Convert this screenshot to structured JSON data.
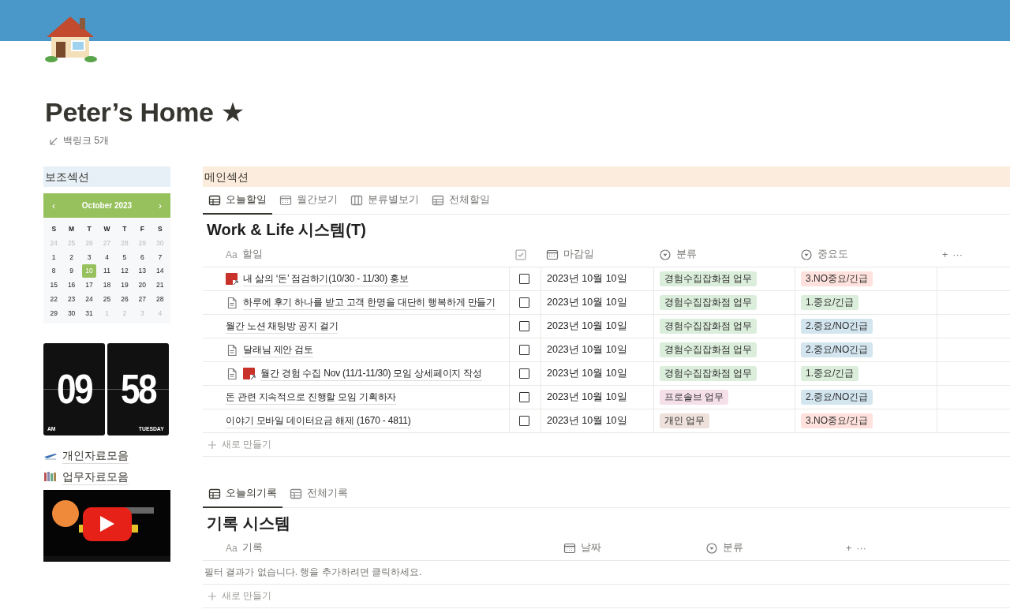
{
  "header": {
    "title": "Peter’s Home ★",
    "backlinks": "백링크 5개"
  },
  "sidebar": {
    "heading": "보조섹션",
    "calendar": {
      "prev": "‹",
      "month": "October 2023",
      "next": "›",
      "weekdays": [
        "S",
        "M",
        "T",
        "W",
        "T",
        "F",
        "S"
      ],
      "days": [
        {
          "day": "24",
          "muted": true,
          "selected": false
        },
        {
          "day": "25",
          "muted": true,
          "selected": false
        },
        {
          "day": "26",
          "muted": true,
          "selected": false
        },
        {
          "day": "27",
          "muted": true,
          "selected": false
        },
        {
          "day": "28",
          "muted": true,
          "selected": false
        },
        {
          "day": "29",
          "muted": true,
          "selected": false
        },
        {
          "day": "30",
          "muted": true,
          "selected": false
        },
        {
          "day": "1",
          "muted": false,
          "selected": false
        },
        {
          "day": "2",
          "muted": false,
          "selected": false
        },
        {
          "day": "3",
          "muted": false,
          "selected": false
        },
        {
          "day": "4",
          "muted": false,
          "selected": false
        },
        {
          "day": "5",
          "muted": false,
          "selected": false
        },
        {
          "day": "6",
          "muted": false,
          "selected": false
        },
        {
          "day": "7",
          "muted": false,
          "selected": false
        },
        {
          "day": "8",
          "muted": false,
          "selected": false
        },
        {
          "day": "9",
          "muted": false,
          "selected": false
        },
        {
          "day": "10",
          "muted": false,
          "selected": true
        },
        {
          "day": "11",
          "muted": false,
          "selected": false
        },
        {
          "day": "12",
          "muted": false,
          "selected": false
        },
        {
          "day": "13",
          "muted": false,
          "selected": false
        },
        {
          "day": "14",
          "muted": false,
          "selected": false
        },
        {
          "day": "15",
          "muted": false,
          "selected": false
        },
        {
          "day": "16",
          "muted": false,
          "selected": false
        },
        {
          "day": "17",
          "muted": false,
          "selected": false
        },
        {
          "day": "18",
          "muted": false,
          "selected": false
        },
        {
          "day": "19",
          "muted": false,
          "selected": false
        },
        {
          "day": "20",
          "muted": false,
          "selected": false
        },
        {
          "day": "21",
          "muted": false,
          "selected": false
        },
        {
          "day": "22",
          "muted": false,
          "selected": false
        },
        {
          "day": "23",
          "muted": false,
          "selected": false
        },
        {
          "day": "24",
          "muted": false,
          "selected": false
        },
        {
          "day": "25",
          "muted": false,
          "selected": false
        },
        {
          "day": "26",
          "muted": false,
          "selected": false
        },
        {
          "day": "27",
          "muted": false,
          "selected": false
        },
        {
          "day": "28",
          "muted": false,
          "selected": false
        },
        {
          "day": "29",
          "muted": false,
          "selected": false
        },
        {
          "day": "30",
          "muted": false,
          "selected": false
        },
        {
          "day": "31",
          "muted": false,
          "selected": false
        },
        {
          "day": "1",
          "muted": true,
          "selected": false
        },
        {
          "day": "2",
          "muted": true,
          "selected": false
        },
        {
          "day": "3",
          "muted": true,
          "selected": false
        },
        {
          "day": "4",
          "muted": true,
          "selected": false
        }
      ]
    },
    "clock": {
      "hour": "09",
      "minute": "58",
      "period": "AM",
      "weekday": "TUESDAY"
    },
    "links": [
      {
        "label": "개인자료모음",
        "kind": "plane"
      },
      {
        "label": "업무자료모음",
        "kind": "books"
      }
    ]
  },
  "main": {
    "heading": "메인섹션",
    "todo": {
      "tabs": [
        {
          "label": "오늘할일",
          "kind": "table",
          "selected": true
        },
        {
          "label": "월간보기",
          "kind": "calendar",
          "selected": false
        },
        {
          "label": "분류별보기",
          "kind": "board",
          "selected": false
        },
        {
          "label": "전체할일",
          "kind": "table",
          "selected": false
        }
      ],
      "title": "Work & Life 시스템(T)",
      "columns": [
        {
          "prefix": "Aa",
          "label": "할일"
        },
        {
          "kind": "checkbox"
        },
        {
          "label": "마감일",
          "kind": "calendar"
        },
        {
          "label": "분류",
          "kind": "select"
        },
        {
          "label": "중요도",
          "kind": "select"
        }
      ],
      "add": "+",
      "more": "···",
      "rows": [
        {
          "icons": [
            {
              "kind": "linked-page"
            }
          ],
          "title": "내 삶의 ‘돈’ 점검하기(10/30 - 11/30) 홍보",
          "done": false,
          "due": "2023년 10월 10일",
          "category": {
            "label": "경험수집잡화점 업무",
            "color": "#dbeddb"
          },
          "priority": {
            "label": "3.NO중요/긴급",
            "color": "#ffe2dd"
          }
        },
        {
          "icons": [
            {
              "kind": "doc"
            }
          ],
          "title": "하루에 후기 하나를 받고 고객 한명을 대단히 행복하게 만들기",
          "done": false,
          "due": "2023년 10월 10일",
          "category": {
            "label": "경험수집잡화점 업무",
            "color": "#dbeddb"
          },
          "priority": {
            "label": "1.중요/긴급",
            "color": "#dbeddb"
          }
        },
        {
          "icons": [],
          "title": "월간 노션 채팅방 공지 걸기",
          "done": false,
          "due": "2023년 10월 10일",
          "category": {
            "label": "경험수집잡화점 업무",
            "color": "#dbeddb"
          },
          "priority": {
            "label": "2.중요/NO긴급",
            "color": "#d3e5ef"
          }
        },
        {
          "icons": [
            {
              "kind": "doc"
            }
          ],
          "title": "달래님 제안 검토",
          "done": false,
          "due": "2023년 10월 10일",
          "category": {
            "label": "경험수집잡화점 업무",
            "color": "#dbeddb"
          },
          "priority": {
            "label": "2.중요/NO긴급",
            "color": "#d3e5ef"
          }
        },
        {
          "icons": [
            {
              "kind": "doc"
            },
            {
              "kind": "linked-page"
            }
          ],
          "title": "월간 경험 수집 Nov (11/1-11/30) 모임 상세페이지 작성",
          "done": false,
          "due": "2023년 10월 10일",
          "category": {
            "label": "경험수집잡화점 업무",
            "color": "#dbeddb"
          },
          "priority": {
            "label": "1.중요/긴급",
            "color": "#dbeddb"
          }
        },
        {
          "icons": [],
          "title": "돈 관련 지속적으로 진행할 모임 기획하자",
          "done": false,
          "due": "2023년 10월 10일",
          "category": {
            "label": "프로솔브 업무",
            "color": "#f5e0e9"
          },
          "priority": {
            "label": "2.중요/NO긴급",
            "color": "#d3e5ef"
          }
        },
        {
          "icons": [],
          "title": "이야기 모바일 데이터요금 해제 (1670 - 4811)",
          "done": false,
          "due": "2023년 10월 10일",
          "category": {
            "label": "개인 업무",
            "color": "#eee0da"
          },
          "priority": {
            "label": "3.NO중요/긴급",
            "color": "#ffe2dd"
          }
        }
      ],
      "new_row": "새로 만들기"
    },
    "records": {
      "tabs": [
        {
          "label": "오늘의기록",
          "kind": "table",
          "selected": true
        },
        {
          "label": "전체기록",
          "kind": "table",
          "selected": false
        }
      ],
      "title": "기록 시스템",
      "columns": [
        {
          "prefix": "Aa",
          "label": "기록"
        },
        {
          "label": "날짜",
          "kind": "calendar"
        },
        {
          "label": "분류",
          "kind": "select"
        }
      ],
      "add": "+",
      "more": "···",
      "empty": "필터 결과가 없습니다. 행을 추가하려면 클릭하세요.",
      "new_row": "새로 만들기"
    }
  }
}
